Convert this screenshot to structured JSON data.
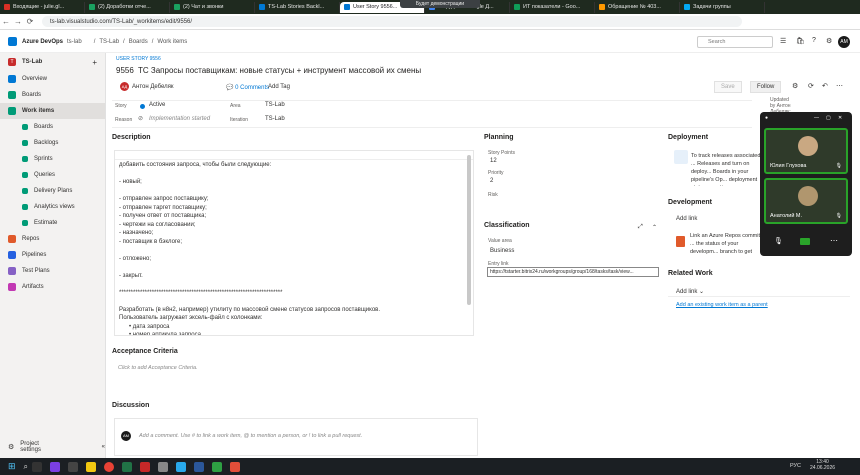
{
  "browser": {
    "tabs": [
      {
        "label": "Входящие - julie.gl...",
        "color": "#d93025"
      },
      {
        "label": "(2) Доработки отче...",
        "color": "#1aa260"
      },
      {
        "label": "(2) Чат и звонки",
        "color": "#1aa260"
      },
      {
        "label": "TS-Lab Stories Backl...",
        "color": "#0078d4"
      },
      {
        "label": "User Story 9556...",
        "color": "#0078d4"
      },
      {
        "label": "...ерудит – Google Д...",
        "color": "#4285f4"
      },
      {
        "label": "ИТ показатели - Goo...",
        "color": "#0f9d58"
      },
      {
        "label": "Обращение № 403...",
        "color": "#ff9800"
      },
      {
        "label": "Задачи группы",
        "color": "#03a9f4"
      }
    ],
    "url": "ts-lab.visualstudio.com/TS-Lab/_workitems/edit/9556/",
    "popup": "Будет демонстрации"
  },
  "header": {
    "brand": "Azure DevOps",
    "org": "ts-lab",
    "crumbs": [
      "TS-Lab",
      "Boards",
      "Work items"
    ],
    "search_placeholder": "Search",
    "user_initials": "AM"
  },
  "sidebar": {
    "project_initial": "T",
    "project": "TS-Lab",
    "items": [
      {
        "label": "Overview",
        "color": "#0078d4"
      },
      {
        "label": "Boards",
        "color": "#009b77"
      },
      {
        "label": "Work items",
        "color": "#009b77"
      },
      {
        "label": "Boards",
        "color": "#009b77"
      },
      {
        "label": "Backlogs",
        "color": "#009b77"
      },
      {
        "label": "Sprints",
        "color": "#009b77"
      },
      {
        "label": "Queries",
        "color": "#009b77"
      },
      {
        "label": "Delivery Plans",
        "color": "#009b77"
      },
      {
        "label": "Analytics views",
        "color": "#009b77"
      },
      {
        "label": "Estimate",
        "color": "#009b77"
      },
      {
        "label": "Repos",
        "color": "#e05a2b"
      },
      {
        "label": "Pipelines",
        "color": "#2560e0"
      },
      {
        "label": "Test Plans",
        "color": "#8661c5"
      },
      {
        "label": "Artifacts",
        "color": "#c239b3"
      }
    ],
    "settings": "Project settings"
  },
  "workitem": {
    "type": "USER STORY 9556",
    "id": "9556",
    "title": "ТС Запросы поставщикам: новые статусы + инструмент массовой их смены",
    "assignee_initials": "АД",
    "assignee": "Антон Дебеляк",
    "comments": "0 Comments",
    "add_tag": "Add Tag",
    "save": "Save",
    "follow": "Follow",
    "updated": "Updated by Антон Дебеляк: Yesterday",
    "state_label": "Story",
    "state": "Active",
    "reason_label": "Reason",
    "reason": "Implementation started",
    "area_label": "Area",
    "area": "TS-Lab",
    "iteration_label": "Iteration",
    "iteration": "TS-Lab"
  },
  "description": {
    "heading": "Description",
    "lines": [
      "добавить состояния запроса, чтобы были следующие:",
      "",
      "- новый;",
      "",
      "- отправлен запрос поставщику;",
      "- отправлен таргет поставщику;",
      "- получен ответ от поставщика;",
      "- чертежи на согласовании;",
      "- назначено;",
      "- поставщик в бэклоге;",
      "",
      "- отложено;",
      "",
      "- закрыт.",
      "",
      "**********************************************************************",
      "",
      "Разработать (в н8н2, например) утилиту по массовой смене статусов запросов поставщиков.",
      "Пользователь загружает эксель-файл с колонками:"
    ],
    "bullets": [
      "дата запроса",
      "номер артикула запроса",
      "новый статус запроса"
    ]
  },
  "acceptance": {
    "heading": "Acceptance Criteria",
    "placeholder": "Click to add Acceptance Criteria."
  },
  "discussion": {
    "heading": "Discussion",
    "placeholder": "Add a comment. Use # to link a work item, @ to mention a person, or ! to link a pull request."
  },
  "planning": {
    "heading": "Planning",
    "story_points_label": "Story Points",
    "story_points": "12",
    "priority_label": "Priority",
    "priority": "2",
    "risk_label": "Risk"
  },
  "classification": {
    "heading": "Classification",
    "value_area_label": "Value area",
    "value_area": "Business",
    "entry_label": "Entry link",
    "entry_value": "https://tstarter.bitrix24.ru/workgroups/group/168/tasks/task/view..."
  },
  "deployment": {
    "heading": "Deployment",
    "text": "To track releases associated ... Releases and turn on deploy... Boards in your pipeline's Op... deployment status reporting"
  },
  "development": {
    "heading": "Development",
    "add_link": "Add link",
    "text": "Link an Azure Repos commit ... the status of your developm... branch to get started."
  },
  "related": {
    "heading": "Related Work",
    "add_link": "Add link",
    "existing": "Add an existing work item as a parent"
  },
  "call": {
    "participants": [
      {
        "name": "Юлия Глухова"
      },
      {
        "name": "Анатолий М."
      }
    ]
  },
  "taskbar": {
    "time": "13:40",
    "date": "24.06.2026",
    "lang": "РУС"
  }
}
